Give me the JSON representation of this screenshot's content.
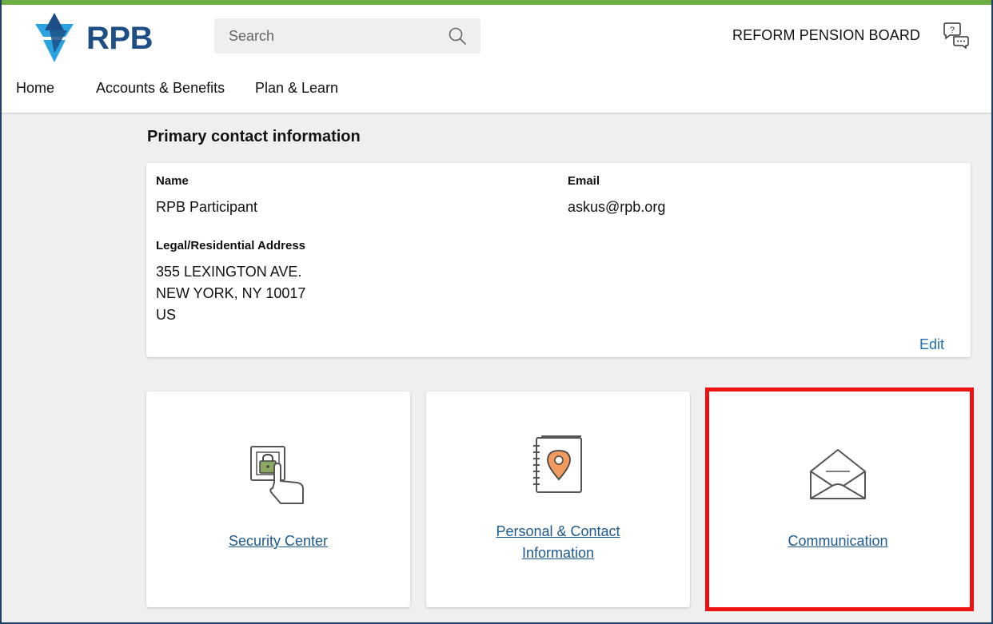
{
  "brand": {
    "logo_text": "RPB",
    "org_name": "REFORM PENSION BOARD",
    "accent_color": "#6cae43",
    "logo_color": "#1d4f86",
    "logo_star_color": "#2ba3e0"
  },
  "search": {
    "placeholder": "Search",
    "icon": "search-icon"
  },
  "help": {
    "icon": "help-chat-icon"
  },
  "nav": {
    "items": [
      {
        "label": "Home"
      },
      {
        "label": "Accounts & Benefits"
      },
      {
        "label": "Plan & Learn"
      }
    ]
  },
  "contact": {
    "title": "Primary contact information",
    "name_label": "Name",
    "name_value": "RPB Participant",
    "email_label": "Email",
    "email_value": "askus@rpb.org",
    "address_label": "Legal/Residential Address",
    "address_lines": [
      "355 LEXINGTON AVE.",
      "NEW YORK, NY 10017",
      "US"
    ],
    "edit_label": "Edit"
  },
  "tiles": [
    {
      "icon": "secure-touch-lock-icon",
      "lines": [
        "Security Center"
      ]
    },
    {
      "icon": "address-book-location-icon",
      "lines": [
        "Personal & Contact",
        "Information"
      ]
    },
    {
      "icon": "envelope-open-icon",
      "lines": [
        "Communication"
      ],
      "highlighted": true
    }
  ],
  "colors": {
    "link": "#1f6db5",
    "highlight_border": "#ee1111",
    "lock_green": "#8aa863",
    "pin_orange": "#f09a5f"
  }
}
